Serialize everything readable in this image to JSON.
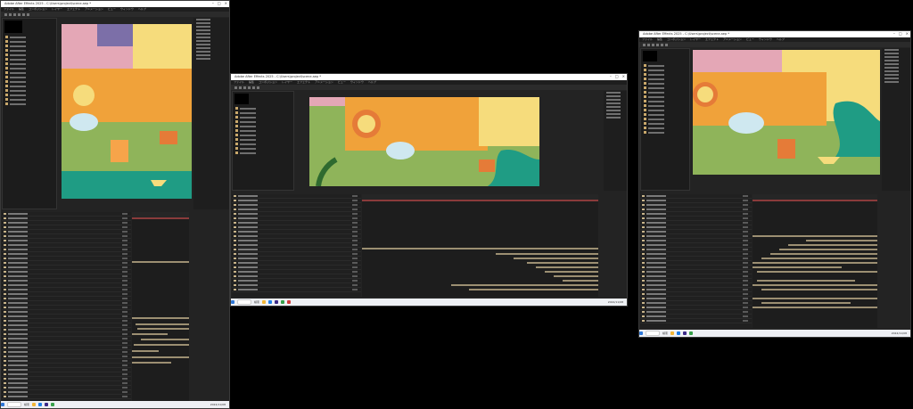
{
  "windows": [
    {
      "id": "left",
      "title": "Adobe After Effects 2025 - C:\\Users\\project\\scene.aep *",
      "menu": [
        "ファイル",
        "編集",
        "コンポジション",
        "レイヤー",
        "エフェクト",
        "アニメーション",
        "ビュー",
        "ウィンドウ",
        "ヘルプ"
      ],
      "taskbar_search": "検索",
      "taskbar_time": "2024/11/08"
    },
    {
      "id": "middle",
      "title": "Adobe After Effects 2025 - C:\\Users\\project\\scene.aep *",
      "menu": [
        "ファイル",
        "編集",
        "コンポジション",
        "レイヤー",
        "エフェクト",
        "アニメーション",
        "ビュー",
        "ウィンドウ",
        "ヘルプ"
      ],
      "taskbar_search": "検索",
      "taskbar_time": "2024/11/08"
    },
    {
      "id": "right",
      "title": "Adobe After Effects 2025 - C:\\Users\\project\\scene.aep *",
      "menu": [
        "ファイル",
        "編集",
        "コンポジション",
        "レイヤー",
        "エフェクト",
        "アニメーション",
        "ビュー",
        "ウィンドウ",
        "ヘルプ"
      ],
      "taskbar_search": "検索",
      "taskbar_time": "2024/11/08"
    }
  ],
  "colors": {
    "bg": "#000000",
    "panel": "#1c1c1c",
    "workarea": "#8a3b3b",
    "layer_bar": "#9c8f72",
    "art_green": "#8fb45a",
    "art_orange": "#f0a23a",
    "art_yellow": "#f6dc7c",
    "art_teal": "#1f9c84",
    "art_pink": "#e4a7b6"
  },
  "icons": [
    "minimize-icon",
    "maximize-icon",
    "close-icon",
    "search-icon",
    "folder-icon",
    "composition-icon",
    "start-icon"
  ]
}
